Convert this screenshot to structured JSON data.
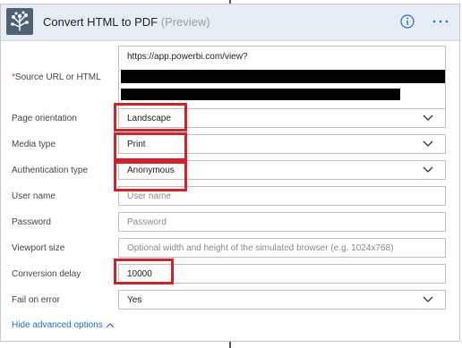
{
  "header": {
    "title": "Convert HTML to PDF",
    "preview_tag": "(Preview)"
  },
  "fields": {
    "source_url": {
      "required_mark": "*",
      "label": "Source URL or HTML",
      "value": "https://app.powerbi.com/view?"
    },
    "page_orientation": {
      "label": "Page orientation",
      "value": "Landscape"
    },
    "media_type": {
      "label": "Media type",
      "value": "Print"
    },
    "authentication_type": {
      "label": "Authentication type",
      "value": "Anonymous"
    },
    "user_name": {
      "label": "User name",
      "placeholder": "User name"
    },
    "password": {
      "label": "Password",
      "placeholder": "Password"
    },
    "viewport_size": {
      "label": "Viewport size",
      "placeholder": "Optional width and height of the simulated browser (e.g. 1024x768)"
    },
    "conversion_delay": {
      "label": "Conversion delay",
      "value": "10000"
    },
    "fail_on_error": {
      "label": "Fail on error",
      "value": "Yes"
    }
  },
  "footer": {
    "advanced_link": "Hide advanced options"
  },
  "colors": {
    "header_bg": "#e6edf5",
    "logo_bg": "#4f6273",
    "accent_blue": "#2b6cc4",
    "highlight_red": "#d61f26"
  },
  "icons": [
    "logo-icon",
    "info-icon",
    "more-icon",
    "chevron-down-icon",
    "chevron-up-icon"
  ]
}
